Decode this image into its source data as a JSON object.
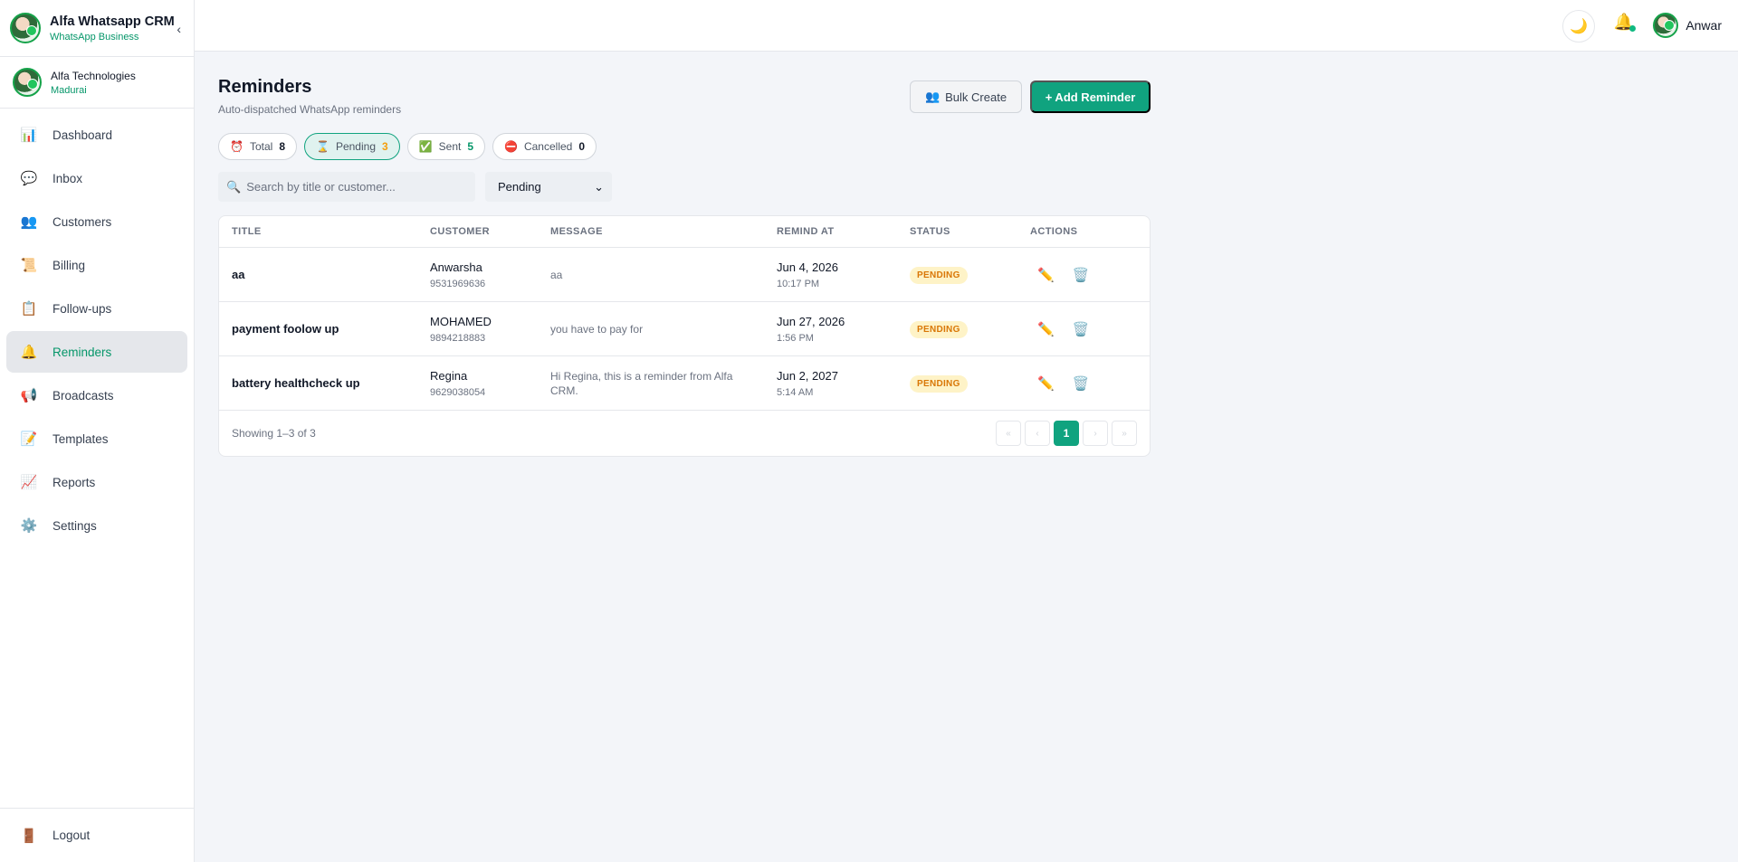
{
  "brand": {
    "title": "Alfa Whatsapp CRM",
    "subtitle": "WhatsApp Business",
    "collapse_icon": "‹"
  },
  "org": {
    "name": "Alfa Technologies",
    "city": "Madurai"
  },
  "nav": [
    {
      "label": "Dashboard",
      "icon": "📊",
      "icon_name": "dashboard-icon"
    },
    {
      "label": "Inbox",
      "icon": "💬",
      "icon_name": "inbox-icon"
    },
    {
      "label": "Customers",
      "icon": "👥",
      "icon_name": "customers-icon"
    },
    {
      "label": "Billing",
      "icon": "📜",
      "icon_name": "billing-icon"
    },
    {
      "label": "Follow-ups",
      "icon": "📋",
      "icon_name": "follow-ups-icon"
    },
    {
      "label": "Reminders",
      "icon": "🔔",
      "icon_name": "reminders-icon",
      "active": true
    },
    {
      "label": "Broadcasts",
      "icon": "📢",
      "icon_name": "broadcasts-icon"
    },
    {
      "label": "Templates",
      "icon": "📝",
      "icon_name": "templates-icon"
    },
    {
      "label": "Reports",
      "icon": "📈",
      "icon_name": "reports-icon"
    },
    {
      "label": "Settings",
      "icon": "⚙️",
      "icon_name": "settings-icon"
    }
  ],
  "logout": {
    "label": "Logout",
    "icon": "🚪"
  },
  "topbar": {
    "theme_icon": "🌙",
    "bell_icon": "🔔",
    "user_name": "Anwar"
  },
  "page": {
    "title": "Reminders",
    "subtitle": "Auto-dispatched WhatsApp reminders",
    "bulk_label": "Bulk Create",
    "bulk_icon": "👥",
    "add_label": "+ Add Reminder"
  },
  "stats": [
    {
      "icon": "⏰",
      "label": "Total",
      "value": "8"
    },
    {
      "icon": "⌛",
      "label": "Pending",
      "value": "3",
      "active": true
    },
    {
      "icon": "✅",
      "label": "Sent",
      "value": "5"
    },
    {
      "icon": "⛔",
      "label": "Cancelled",
      "value": "0"
    }
  ],
  "filters": {
    "search_icon": "🔍",
    "search_placeholder": "Search by title or customer...",
    "status_value": "Pending",
    "chevron": "⌄"
  },
  "table": {
    "headers": [
      "TITLE",
      "CUSTOMER",
      "MESSAGE",
      "REMIND AT",
      "STATUS",
      "ACTIONS"
    ],
    "rows": [
      {
        "title": "aa",
        "customer": "Anwarsha",
        "phone": "9531969636",
        "message": "aa",
        "date": "Jun 4, 2026",
        "time": "10:17 PM",
        "status": "PENDING"
      },
      {
        "title": "payment foolow up",
        "customer": "MOHAMED",
        "phone": "9894218883",
        "message": "you have to pay for",
        "date": "Jun 27, 2026",
        "time": "1:56 PM",
        "status": "PENDING"
      },
      {
        "title": "battery healthcheck up",
        "customer": "Regina",
        "phone": "9629038054",
        "message": "Hi Regina, this is a reminder from Alfa CRM.",
        "date": "Jun 2, 2027",
        "time": "5:14 AM",
        "status": "PENDING"
      }
    ],
    "edit_icon": "✏️",
    "delete_icon": "🗑️",
    "footer_text": "Showing 1–3 of 3",
    "pager": {
      "first": "«",
      "prev": "‹",
      "current": "1",
      "next": "›",
      "last": "»"
    }
  }
}
